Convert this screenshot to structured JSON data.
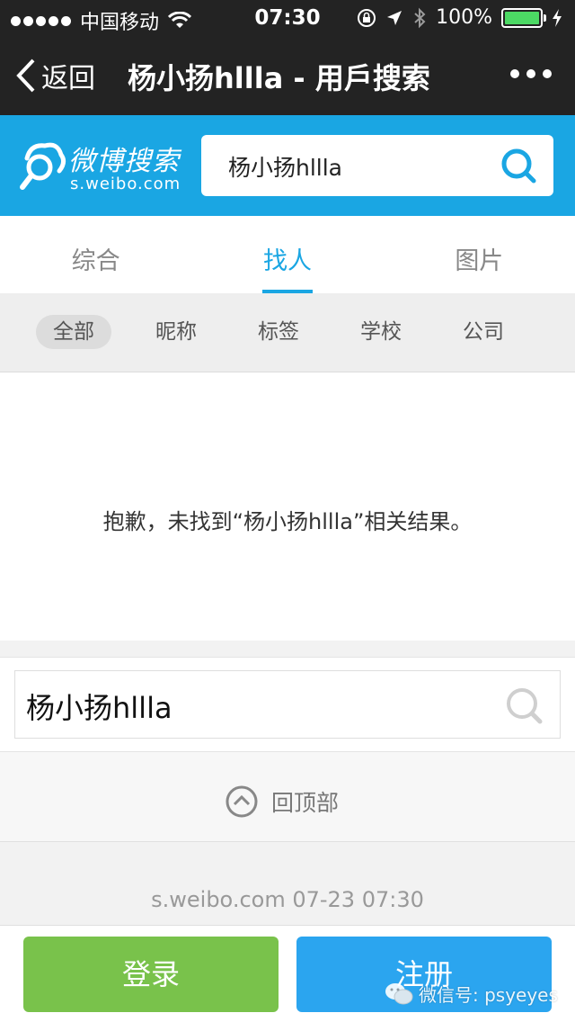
{
  "status_bar": {
    "carrier": "中国移动",
    "time": "07:30",
    "battery": "100%",
    "battery_level": 1.0,
    "icons": [
      "signal-dots-icon",
      "wifi-icon",
      "rotation-lock-icon",
      "location-arrow-icon",
      "bluetooth-icon",
      "battery-icon",
      "charging-icon"
    ]
  },
  "nav": {
    "back_label": "返回",
    "title": "杨小扬hllla - 用戶搜索",
    "more_icon": "more-dots-icon"
  },
  "header": {
    "logo_text": "微博搜索",
    "logo_domain": "s.weibo.com",
    "search_query": "杨小扬hllla",
    "brand_color": "#1aa6e3"
  },
  "tabs": [
    {
      "label": "综合",
      "active": false
    },
    {
      "label": "找人",
      "active": true
    },
    {
      "label": "图片",
      "active": false
    }
  ],
  "filters": [
    {
      "label": "全部",
      "active": true
    },
    {
      "label": "昵称",
      "active": false
    },
    {
      "label": "标签",
      "active": false
    },
    {
      "label": "学校",
      "active": false
    },
    {
      "label": "公司",
      "active": false
    }
  ],
  "empty_message": "抱歉，未找到“杨小扬hllla”相关结果。",
  "bottom_search": {
    "query": "杨小扬hllla"
  },
  "back_to_top": "回顶部",
  "footer": "s.weibo.com 07-23 07:30",
  "buttons": {
    "login": "登录",
    "register": "注册",
    "login_color": "#79c24b",
    "register_color": "#2ba5ef"
  },
  "watermark": "微信号: psyeyes"
}
